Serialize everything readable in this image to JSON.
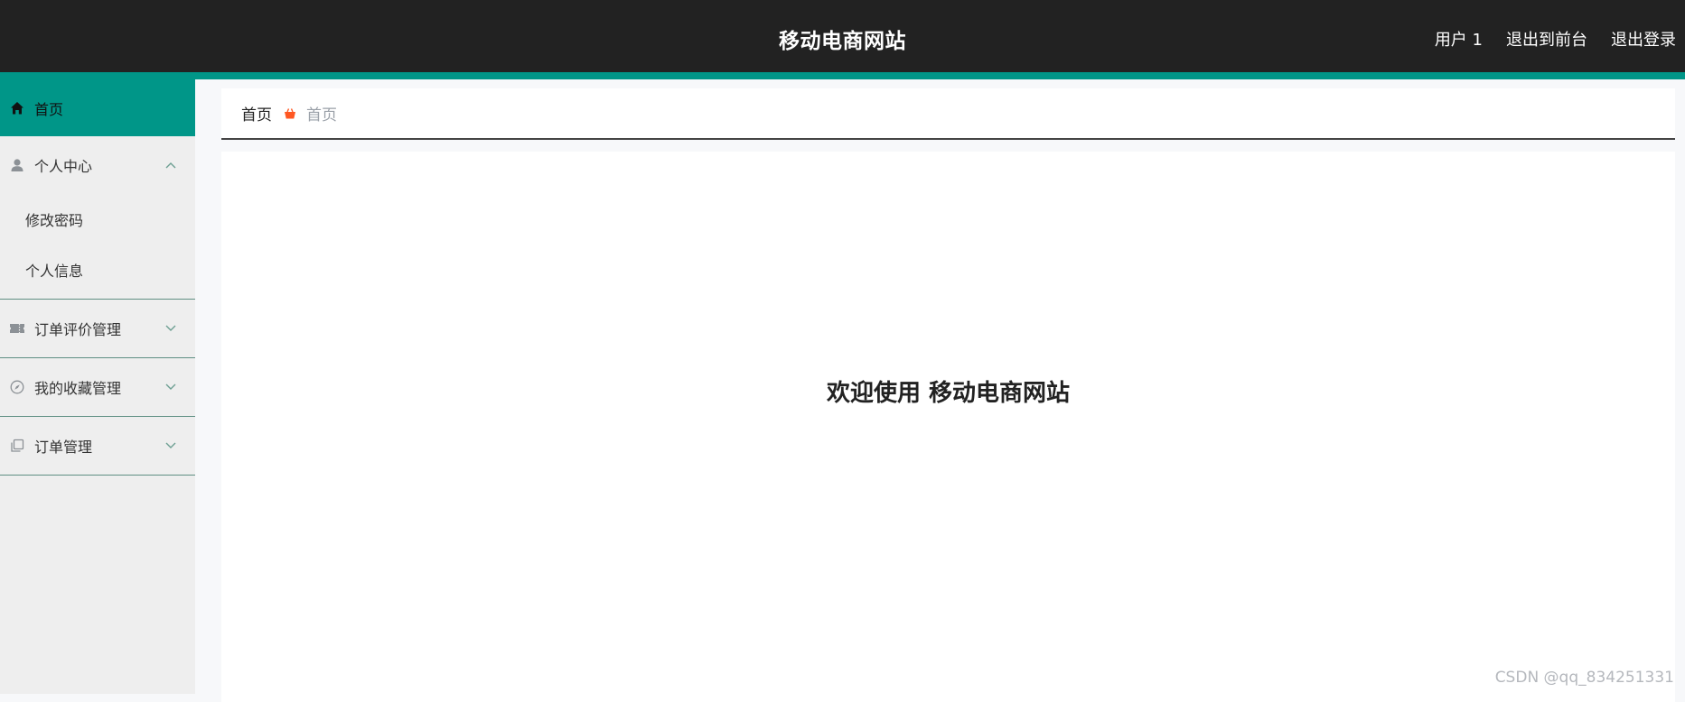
{
  "header": {
    "site_title": "移动电商网站",
    "user_label": "用户 1",
    "to_front_label": "退出到前台",
    "logout_label": "退出登录"
  },
  "sidebar": {
    "home_label": "首页",
    "groups": [
      {
        "label": "个人中心",
        "icon": "user-icon",
        "expanded": true,
        "items": [
          "修改密码",
          "个人信息"
        ]
      },
      {
        "label": "订单评价管理",
        "icon": "ticket-icon",
        "expanded": false
      },
      {
        "label": "我的收藏管理",
        "icon": "compass-icon",
        "expanded": false
      },
      {
        "label": "订单管理",
        "icon": "copy-icon",
        "expanded": false
      }
    ]
  },
  "breadcrumb": {
    "root": "首页",
    "current": "首页",
    "separator_icon": "basket-icon"
  },
  "main": {
    "welcome": "欢迎使用 移动电商网站"
  },
  "watermark": "CSDN @qq_834251331",
  "colors": {
    "topbar_bg": "#222222",
    "accent": "#009688",
    "sidebar_bg": "#eeeeee",
    "separator_icon": "#ff5722"
  }
}
